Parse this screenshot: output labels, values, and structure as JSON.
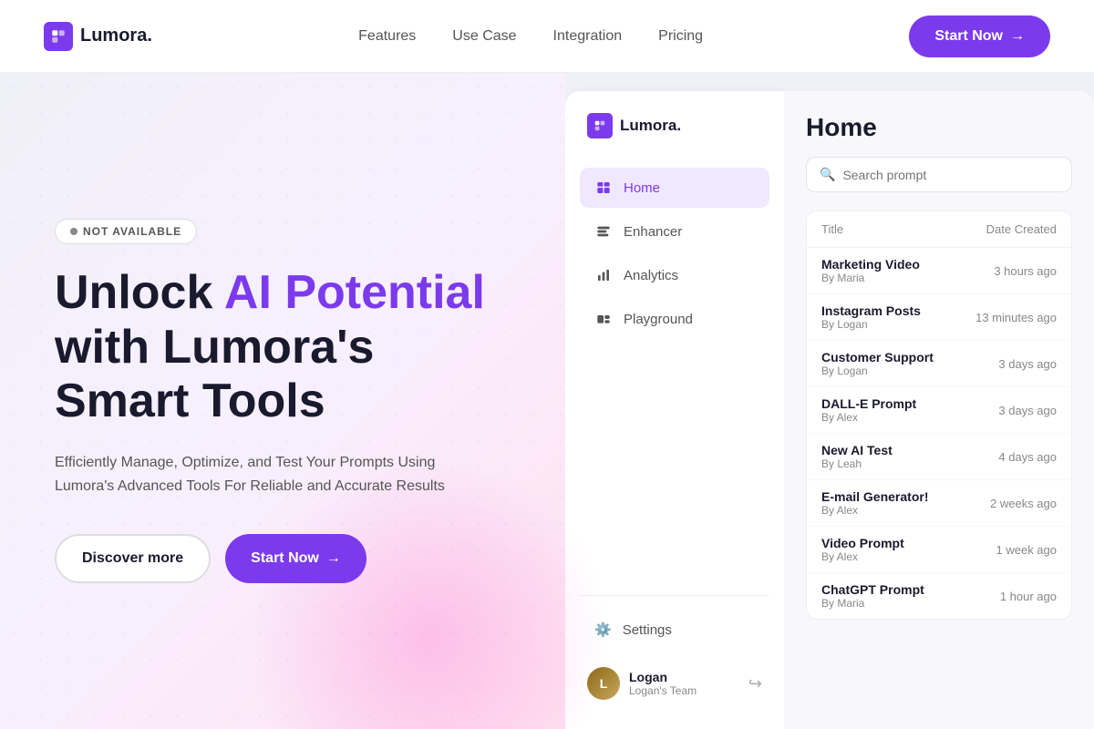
{
  "header": {
    "logo_text": "Lumora.",
    "nav": [
      {
        "label": "Features",
        "id": "features"
      },
      {
        "label": "Use Case",
        "id": "use-case"
      },
      {
        "label": "Integration",
        "id": "integration"
      },
      {
        "label": "Pricing",
        "id": "pricing"
      }
    ],
    "cta_label": "Start Now"
  },
  "hero": {
    "badge": "NOT AVAILABLE",
    "title_part1": "Unlock ",
    "title_highlight": "AI Potential",
    "title_part2": " with Lumora's Smart Tools",
    "subtitle": "Efficiently Manage, Optimize, and Test Your Prompts Using Lumora's Advanced Tools For Reliable and Accurate Results",
    "btn_discover": "Discover more",
    "btn_start": "Start Now"
  },
  "sidebar": {
    "logo_text": "Lumora.",
    "nav_items": [
      {
        "label": "Home",
        "icon": "🏠",
        "active": true,
        "id": "home"
      },
      {
        "label": "Enhancer",
        "icon": "⚡",
        "active": false,
        "id": "enhancer"
      },
      {
        "label": "Analytics",
        "icon": "📊",
        "active": false,
        "id": "analytics"
      },
      {
        "label": "Playground",
        "icon": "🎮",
        "active": false,
        "id": "playground"
      }
    ],
    "settings_label": "Settings",
    "user": {
      "name": "Logan",
      "team": "Logan's Team"
    }
  },
  "main_panel": {
    "title": "Home",
    "search_placeholder": "Search prompt",
    "table": {
      "col_title": "Title",
      "col_date": "Date Created",
      "rows": [
        {
          "title": "Marketing Video",
          "by": "By Maria",
          "date": "3 hours ago"
        },
        {
          "title": "Instagram Posts",
          "by": "By Logan",
          "date": "13 minutes ago"
        },
        {
          "title": "Customer Support",
          "by": "By Logan",
          "date": "3 days ago"
        },
        {
          "title": "DALL-E Prompt",
          "by": "By Alex",
          "date": "3 days ago"
        },
        {
          "title": "New AI Test",
          "by": "By Leah",
          "date": "4 days ago"
        },
        {
          "title": "E-mail Generator!",
          "by": "By Alex",
          "date": "2 weeks ago"
        },
        {
          "title": "Video Prompt",
          "by": "By Alex",
          "date": "1 week ago"
        },
        {
          "title": "ChatGPT Prompt",
          "by": "By Maria",
          "date": "1 hour ago"
        }
      ]
    }
  }
}
